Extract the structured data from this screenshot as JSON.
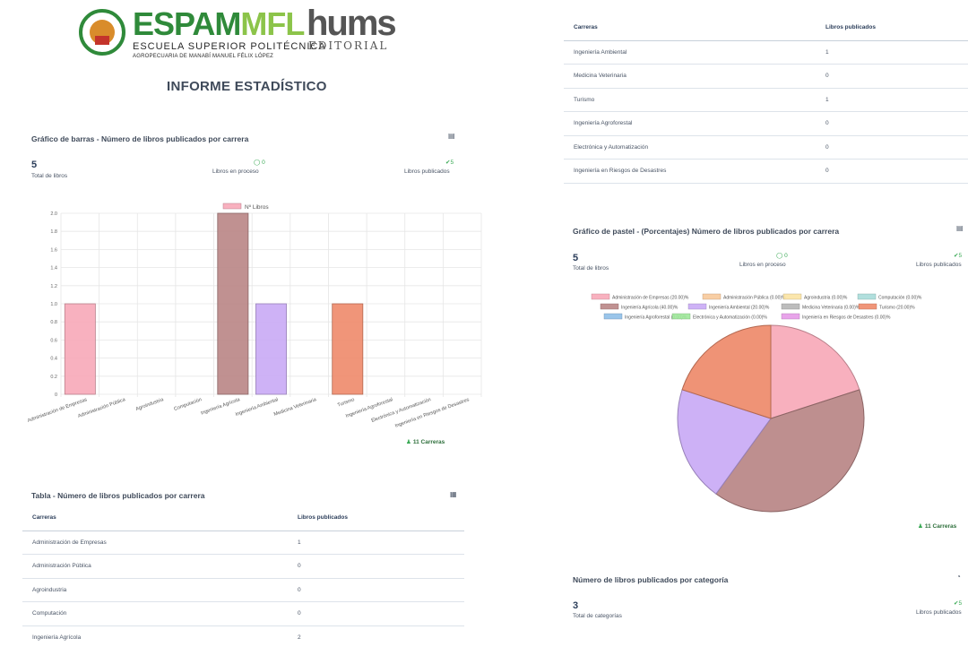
{
  "header": {
    "espam_name": "ESPAM",
    "espam_mfl": "MFL",
    "espam_sub1": "ESCUELA SUPERIOR POLITÉCNICA",
    "espam_sub2": "AGROPECUARIA DE MANABÍ MANUEL FÉLIX LÓPEZ",
    "hums_name": "hums",
    "hums_sub": "EDITORIAL",
    "report_title": "INFORME ESTADÍSTICO"
  },
  "bar_section": {
    "title": "Gráfico de barras - Número de libros publicados por carrera",
    "total_value": "5",
    "total_label": "Total de libros",
    "process_value": "0",
    "process_label": "Libros en proceso",
    "published_value": "5",
    "published_label": "Libros publicados",
    "carreras_badge": "11 Carreras"
  },
  "table_section": {
    "title": "Tabla - Número de libros publicados por carrera",
    "col_carreras": "Carreras",
    "col_libros": "Libros publicados",
    "rows": [
      [
        "Administración de Empresas",
        "1"
      ],
      [
        "Administración Pública",
        "0"
      ],
      [
        "Agroindustria",
        "0"
      ],
      [
        "Computación",
        "0"
      ],
      [
        "Ingeniería Agrícola",
        "2"
      ]
    ]
  },
  "right_table": {
    "col_carreras": "Carreras",
    "col_libros": "Libros publicados",
    "rows": [
      [
        "Ingeniería Ambiental",
        "1"
      ],
      [
        "Medicina Veterinaria",
        "0"
      ],
      [
        "Turismo",
        "1"
      ],
      [
        "Ingeniería Agroforestal",
        "0"
      ],
      [
        "Electrónica y Automatización",
        "0"
      ],
      [
        "Ingeniería en Riesgos de Desastres",
        "0"
      ]
    ]
  },
  "pie_section": {
    "title": "Gráfico de pastel - (Porcentajes) Número de libros publicados por carrera",
    "total_value": "5",
    "total_label": "Total de libros",
    "process_value": "0",
    "process_label": "Libros en proceso",
    "published_value": "5",
    "published_label": "Libros publicados",
    "carreras_badge": "11 Carreras"
  },
  "category_section": {
    "title": "Número de libros publicados por categoría",
    "total_value": "3",
    "total_label": "Total de categorías",
    "published_value": "5",
    "published_label": "Libros publicados"
  },
  "chart_data": [
    {
      "type": "bar",
      "legend": "Nº Libros",
      "categories": [
        "Administración de Empresas",
        "Administración Pública",
        "Agroindustria",
        "Computación",
        "Ingeniería Agrícola",
        "Ingeniería Ambiental",
        "Medicina Veterinaria",
        "Turismo",
        "Ingeniería Agroforestal",
        "Electrónica y Automatización",
        "Ingeniería en Riesgos de Desastres"
      ],
      "values": [
        1,
        0,
        0,
        0,
        2,
        1,
        0,
        1,
        0,
        0,
        0
      ],
      "colors": [
        "#f7a9b8",
        "#f7c99a",
        "#fbe3a3",
        "#a8dcd9",
        "#b98585",
        "#c9aaf5",
        "#b5b5b5",
        "#ee8a6a",
        "#8fbfe8",
        "#9fe89a",
        "#e59ae8"
      ],
      "ylim": [
        0,
        2.0
      ],
      "yticks": [
        "0",
        "0.2",
        "0.4",
        "0.6",
        "0.8",
        "1.0",
        "1.2",
        "1.4",
        "1.6",
        "1.8",
        "2.0"
      ],
      "grid": true,
      "legend_position": "top"
    },
    {
      "type": "pie",
      "labels": [
        "Administración de Empresas (20.00)%",
        "Administración Pública (0.00)%",
        "Agroindustria (0.00)%",
        "Computación (0.00)%",
        "Ingeniería Agrícola (40.00)%",
        "Ingeniería Ambiental (20.00)%",
        "Medicina Veterinaria (0.00)%",
        "Turismo (20.00)%",
        "Ingeniería Agroforestal (0.00)%",
        "Electrónica y Automatización (0.00)%",
        "Ingeniería en Riesgos de Desastres (0.00)%"
      ],
      "values": [
        20,
        0,
        0,
        0,
        40,
        20,
        0,
        20,
        0,
        0,
        0
      ],
      "colors": [
        "#f7a9b8",
        "#f7c99a",
        "#fbe3a3",
        "#a8dcd9",
        "#b98585",
        "#c9aaf5",
        "#b5b5b5",
        "#ee8a6a",
        "#8fbfe8",
        "#9fe89a",
        "#e59ae8"
      ],
      "legend_position": "top"
    }
  ]
}
